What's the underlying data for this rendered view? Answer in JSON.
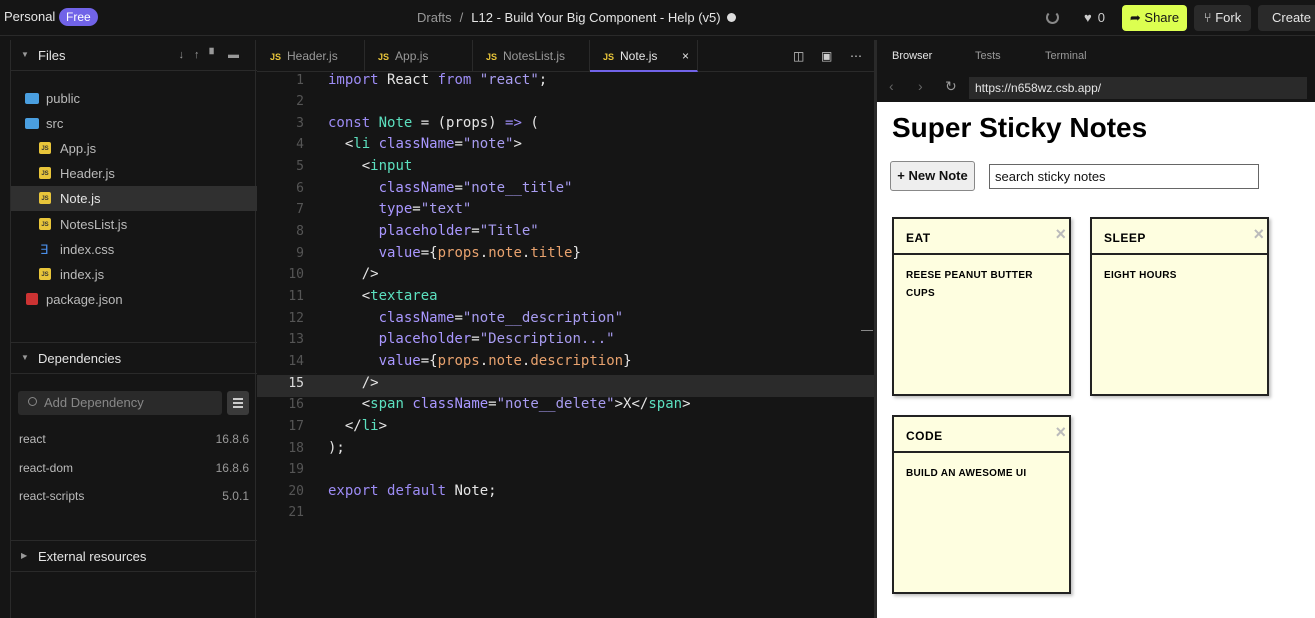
{
  "topbar": {
    "workspace": "Personal",
    "plan_badge": "Free",
    "breadcrumb_root": "Drafts",
    "breadcrumb_sep": "/",
    "sandbox_title": "L12 - Build Your Big Component - Help (v5)",
    "likes": "0",
    "share_label": "Share",
    "fork_label": "Fork",
    "create_label": "Create"
  },
  "sidebar": {
    "files_header": "Files",
    "tree": [
      {
        "label": "public",
        "icon": "folder-icon"
      },
      {
        "label": "src",
        "icon": "folder-icon"
      },
      {
        "label": "App.js",
        "icon": "js-file-icon"
      },
      {
        "label": "Header.js",
        "icon": "js-file-icon"
      },
      {
        "label": "Note.js",
        "icon": "js-file-icon",
        "selected": true
      },
      {
        "label": "NotesList.js",
        "icon": "js-file-icon"
      },
      {
        "label": "index.css",
        "icon": "css-file-icon"
      },
      {
        "label": "index.js",
        "icon": "js-file-icon"
      },
      {
        "label": "package.json",
        "icon": "npm-icon"
      }
    ],
    "dependencies_header": "Dependencies",
    "dep_search_placeholder": "Add Dependency",
    "dependencies": [
      {
        "name": "react",
        "version": "16.8.6"
      },
      {
        "name": "react-dom",
        "version": "16.8.6"
      },
      {
        "name": "react-scripts",
        "version": "5.0.1"
      }
    ],
    "external_header": "External resources"
  },
  "editor": {
    "tabs": [
      {
        "label": "Header.js"
      },
      {
        "label": "App.js"
      },
      {
        "label": "NotesList.js"
      },
      {
        "label": "Note.js",
        "active": true
      }
    ],
    "tab_close": "×",
    "current_line": 15,
    "line_numbers": [
      "1",
      "2",
      "3",
      "4",
      "5",
      "6",
      "7",
      "8",
      "9",
      "10",
      "11",
      "12",
      "13",
      "14",
      "15",
      "16",
      "17",
      "18",
      "19",
      "20",
      "21"
    ]
  },
  "browser": {
    "tabs": [
      "Browser",
      "Tests",
      "Terminal"
    ],
    "url": "https://n658wz.csb.app/",
    "app_title": "Super Sticky Notes",
    "new_note_label": "+ New Note",
    "search_value": "search sticky notes",
    "notes": [
      {
        "title": "eat",
        "description": "reese peanut butter cups",
        "delete": "×"
      },
      {
        "title": "sleep",
        "description": "eight hours",
        "delete": "×"
      },
      {
        "title": "code",
        "description": "build an awesome UI",
        "delete": "×"
      }
    ]
  },
  "colors": {
    "accent": "#7163e8",
    "share_button": "#dcff50",
    "note_bg": "#fefee0"
  }
}
